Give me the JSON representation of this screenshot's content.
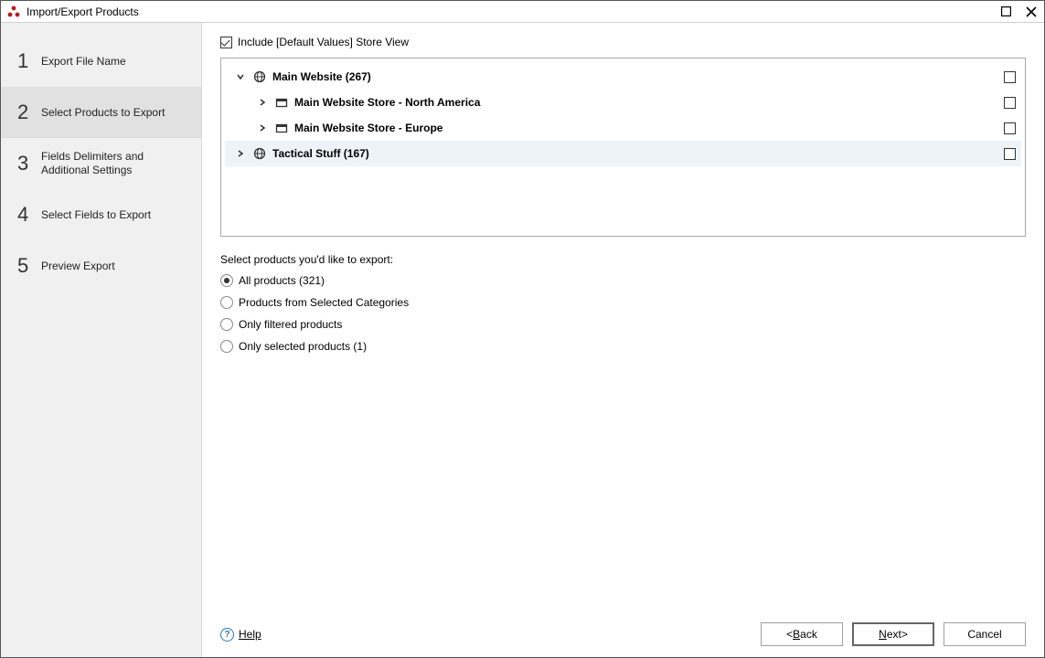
{
  "window": {
    "title": "Import/Export Products"
  },
  "sidebar": {
    "steps": [
      {
        "num": "1",
        "label": "Export File Name"
      },
      {
        "num": "2",
        "label": "Select Products to Export"
      },
      {
        "num": "3",
        "label": "Fields Delimiters and Additional Settings"
      },
      {
        "num": "4",
        "label": "Select Fields to Export"
      },
      {
        "num": "5",
        "label": "Preview Export"
      }
    ],
    "selected_index": 1
  },
  "main": {
    "include_default_label": "Include [Default Values] Store View",
    "include_default_checked": true,
    "tree": [
      {
        "level": 0,
        "expanded": true,
        "icon": "globe",
        "label": "Main Website (267)",
        "checked": false
      },
      {
        "level": 1,
        "expanded": false,
        "icon": "store",
        "label": "Main Website Store - North America",
        "checked": false
      },
      {
        "level": 1,
        "expanded": false,
        "icon": "store",
        "label": "Main Website Store - Europe",
        "checked": false
      },
      {
        "level": 0,
        "expanded": false,
        "icon": "globe",
        "label": "Tactical Stuff (167)",
        "checked": false,
        "hovered": true
      }
    ],
    "select_label": "Select products you'd like to export:",
    "radios": [
      {
        "label": "All products (321)",
        "checked": true
      },
      {
        "label": "Products from Selected Categories",
        "checked": false
      },
      {
        "label": "Only filtered products",
        "checked": false
      },
      {
        "label": "Only selected products (1)",
        "checked": false
      }
    ]
  },
  "footer": {
    "help": "Help",
    "back": "Back",
    "next": "Next",
    "cancel": "Cancel"
  }
}
